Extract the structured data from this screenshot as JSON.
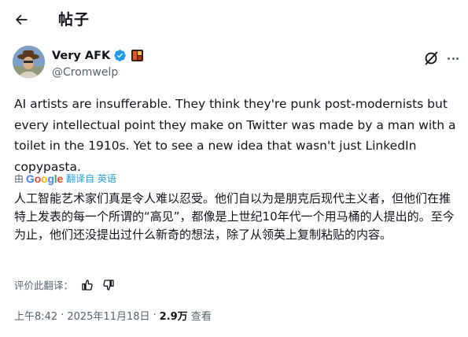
{
  "header": {
    "title": "帖子"
  },
  "author": {
    "name": "Very AFK",
    "handle": "@Cromwelp"
  },
  "post": {
    "text": "AI artists are insufferable. They think they're punk post-modernists but every intellectual point they make on Twitter was made by a man with a toilet in the 1910s. Yet to see a new idea that wasn't just LinkedIn copypasta."
  },
  "translation": {
    "by_label": "由",
    "provider": "Google",
    "action_label": "翻译自 英语",
    "text": "人工智能艺术家们真是令人难以忍受。他们自以为是朋克后现代主义者，但他们在推特上发表的每一个所谓的“高见”，都像是上世纪10年代一个用马桶的人提出的。至今为止，他们还没提出过什么新奇的想法，除了从领英上复制粘贴的内容。",
    "rate_label": "评价此翻译："
  },
  "meta": {
    "time": "上午8:42",
    "separator": "·",
    "date": "2025年11月18日",
    "views_count": "2.9万",
    "views_label": "查看"
  },
  "colors": {
    "verified": "#1d9bf0",
    "link": "#1d9bf0",
    "secondary_text": "#536471"
  },
  "icons": {
    "back": "arrow-left-icon",
    "verified": "verified-badge-icon",
    "affiliate": "affiliate-badge-icon",
    "grok": "grok-icon",
    "more": "more-horizontal-icon",
    "thumbs_up": "thumbs-up-icon",
    "thumbs_down": "thumbs-down-icon"
  }
}
